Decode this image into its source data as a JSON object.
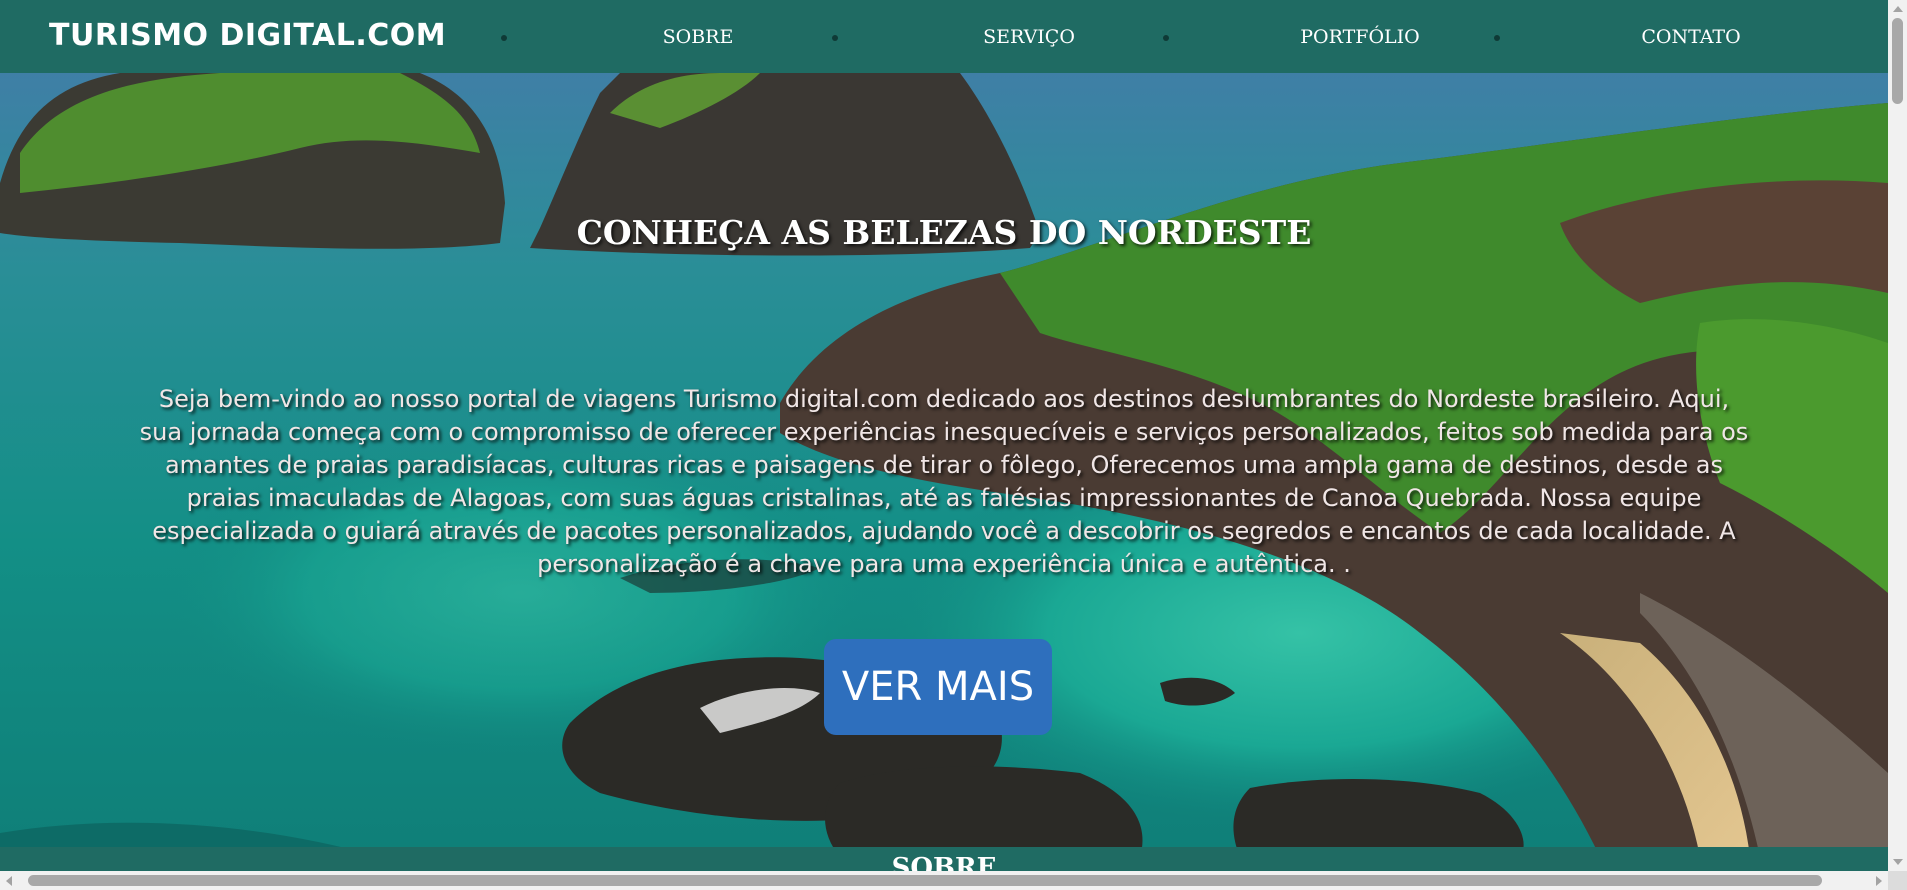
{
  "navbar": {
    "brand": "TURISMO DIGITAL.COM",
    "items": [
      {
        "label": "SOBRE"
      },
      {
        "label": "SERVIÇO"
      },
      {
        "label": "PORTFÓLIO"
      },
      {
        "label": "CONTATO"
      }
    ],
    "background": "#1f6b63"
  },
  "hero": {
    "title": "CONHEÇA AS BELEZAS DO NORDESTE",
    "description": "Seja bem-vindo ao nosso portal de viagens Turismo digital.com dedicado aos destinos deslumbrantes do Nordeste brasileiro. Aqui, sua jornada começa com o compromisso de oferecer experiências inesquecíveis e serviços personalizados, feitos sob medida para os amantes de praias paradisíacas, culturas ricas e paisagens de tirar o fôlego, Oferecemos uma ampla gama de destinos, desde as praias imaculadas de Alagoas, com suas águas cristalinas, até as falésias impressionantes de Canoa Quebrada. Nossa equipe especializada o guiará através de pacotes personalizados, ajudando você a descobrir os segredos e encantos de cada localidade. A personalização é a chave para uma experiência única e autêntica. .",
    "cta_label": "VER MAIS",
    "cta_color": "#2e6fbd",
    "background_image": "coastal-landscape-image"
  },
  "next_section": {
    "title": "SOBRE"
  }
}
